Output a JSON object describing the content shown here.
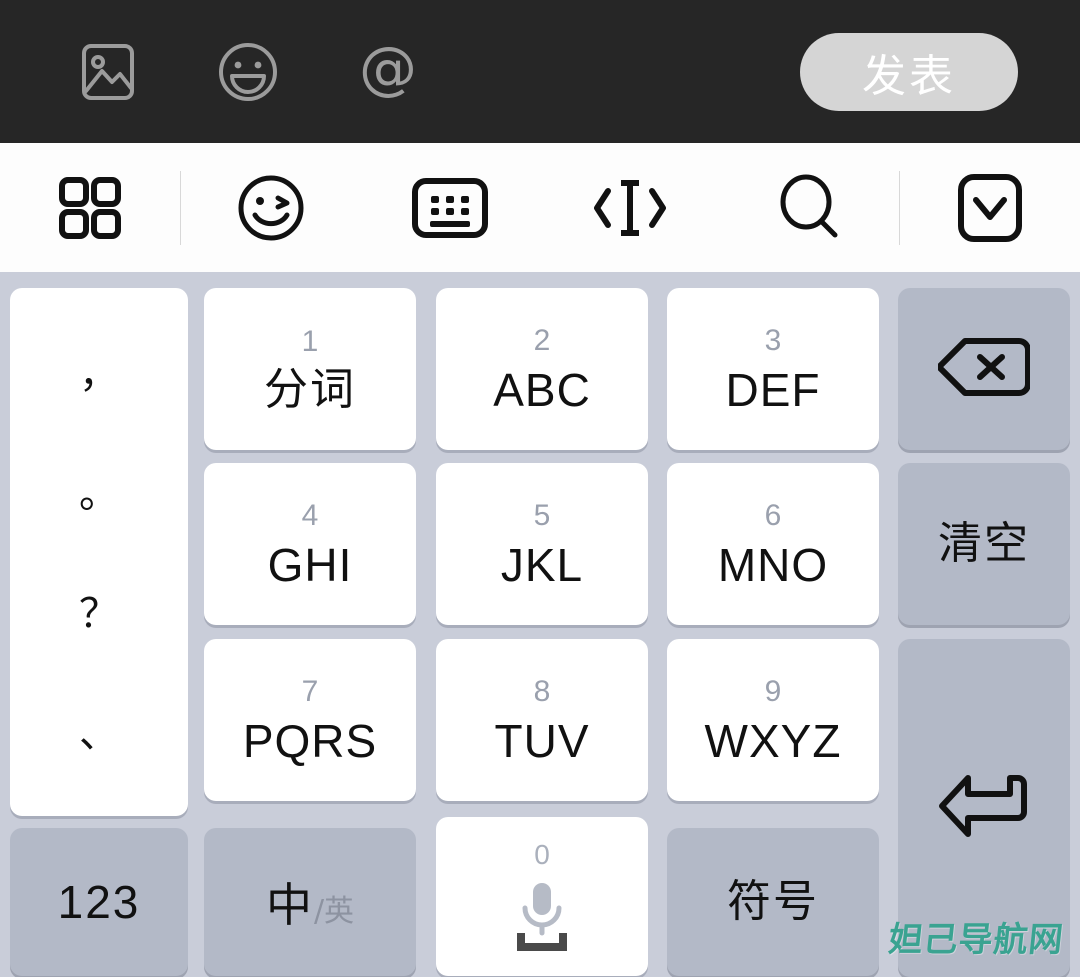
{
  "compose_bar": {
    "background_color": "#262626",
    "icons": [
      {
        "name": "image-icon",
        "label": "图片"
      },
      {
        "name": "emoji-icon",
        "label": "表情"
      },
      {
        "name": "mention-at-icon",
        "label": "@"
      }
    ],
    "post_button": {
      "label": "发表",
      "bg_color": "#d5d5d5",
      "text_color": "#ffffff"
    }
  },
  "keyboard_toolbar": {
    "background_color": "#fdfdfd",
    "items": [
      {
        "name": "grid-apps-icon",
        "label": "更多"
      },
      {
        "name": "emoji-wink-icon",
        "label": "表情"
      },
      {
        "name": "keyboard-icon",
        "label": "键盘"
      },
      {
        "name": "cursor-move-icon",
        "label": "移动光标"
      },
      {
        "name": "search-icon",
        "label": "搜索"
      },
      {
        "name": "chevron-down-icon",
        "label": "收起键盘"
      }
    ]
  },
  "keyboard": {
    "background_color": "#c9cdd9",
    "key_bg": "#ffffff",
    "fn_key_bg": "#b3b9c7",
    "punctuation_key": {
      "name": "punctuation-key",
      "symbols": [
        "，",
        "。",
        "？",
        "、"
      ]
    },
    "t9_keys": [
      {
        "digit": "1",
        "letters": "分词",
        "is_cn": true
      },
      {
        "digit": "2",
        "letters": "ABC",
        "is_cn": false
      },
      {
        "digit": "3",
        "letters": "DEF",
        "is_cn": false
      },
      {
        "digit": "4",
        "letters": "GHI",
        "is_cn": false
      },
      {
        "digit": "5",
        "letters": "JKL",
        "is_cn": false
      },
      {
        "digit": "6",
        "letters": "MNO",
        "is_cn": false
      },
      {
        "digit": "7",
        "letters": "PQRS",
        "is_cn": false
      },
      {
        "digit": "8",
        "letters": "TUV",
        "is_cn": false
      },
      {
        "digit": "9",
        "letters": "WXYZ",
        "is_cn": false
      }
    ],
    "right_column": [
      {
        "name": "backspace-key",
        "label": "退格",
        "icon": "backspace-icon"
      },
      {
        "name": "clear-key",
        "label": "清空",
        "icon": null
      },
      {
        "name": "enter-key",
        "label": "回车",
        "icon": "enter-return-icon"
      }
    ],
    "bottom_row": {
      "numeric_key": {
        "name": "numeric-mode-key",
        "label": "123"
      },
      "lang_key": {
        "name": "language-toggle-key",
        "primary": "中",
        "secondary": "/英"
      },
      "space_key": {
        "name": "space-key",
        "digit": "0",
        "icon": "microphone-icon"
      },
      "symbol_key": {
        "name": "symbol-key",
        "label": "符号"
      }
    }
  },
  "watermark": {
    "text": "妲己导航网",
    "color": "#3aa391"
  }
}
